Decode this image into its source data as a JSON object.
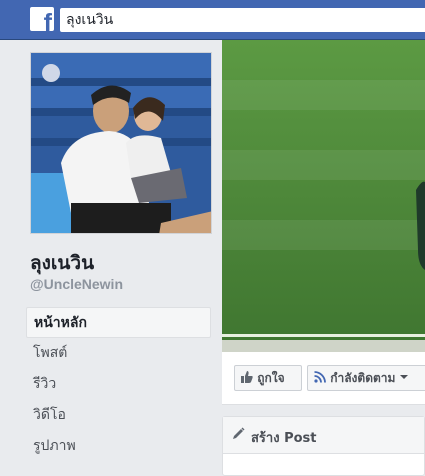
{
  "topbar": {
    "logo_letter": "f",
    "search_value": "ลุงเนวิน"
  },
  "profile": {
    "name": "ลุงเนวิน",
    "handle": "@UncleNewin"
  },
  "nav": {
    "items": [
      "หน้าหลัก",
      "โพสต์",
      "รีวิว",
      "วิดีโอ",
      "รูปภาพ"
    ]
  },
  "actions": {
    "like_label": "ถูกใจ",
    "follow_label": "กำลังติดตาม"
  },
  "composer": {
    "title": "สร้าง Post"
  },
  "colors": {
    "brand": "#4267b2",
    "background": "#e9ebee",
    "grass": "#4f8a3a"
  }
}
